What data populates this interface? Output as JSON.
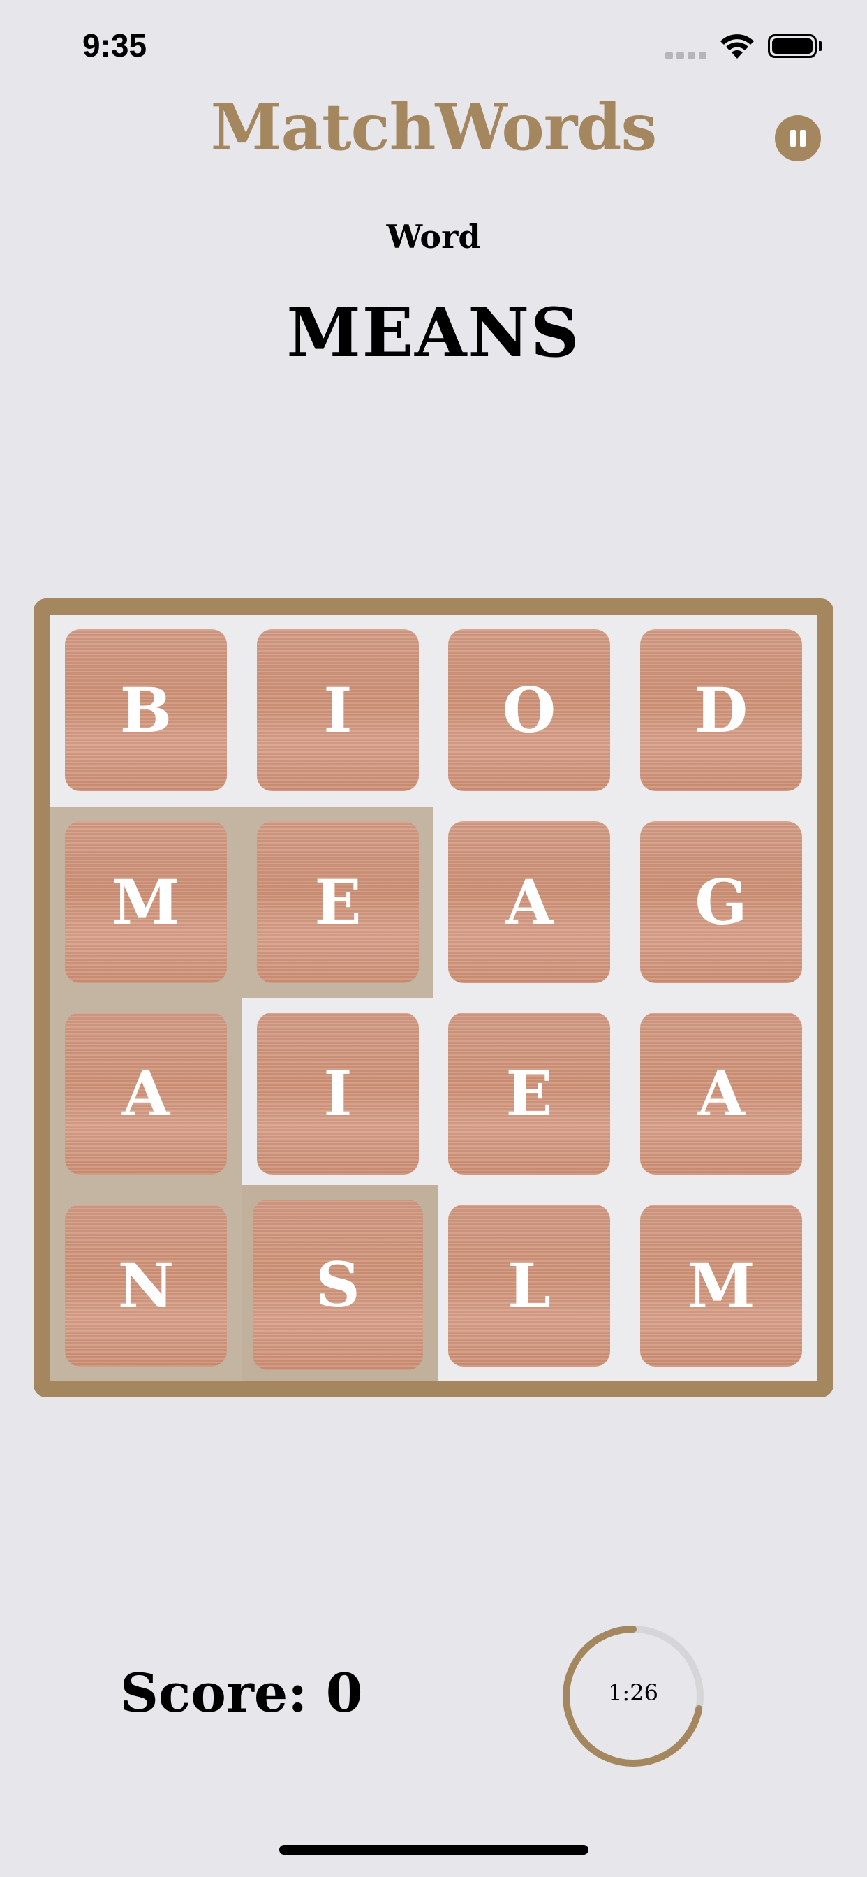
{
  "status_bar": {
    "time": "9:35"
  },
  "header": {
    "title": "MatchWords",
    "pause_icon": "pause-icon"
  },
  "prompt": {
    "label": "Word",
    "word": "MEANS"
  },
  "board": {
    "rows": [
      [
        "B",
        "I",
        "O",
        "D"
      ],
      [
        "M",
        "E",
        "A",
        "G"
      ],
      [
        "A",
        "I",
        "E",
        "A"
      ],
      [
        "N",
        "S",
        "L",
        "M"
      ]
    ],
    "selected_path": [
      "M",
      "E",
      "A",
      "N",
      "S"
    ]
  },
  "footer": {
    "score": "Score: 0",
    "timer": "1:26",
    "timer_fraction_remaining": 0.72
  },
  "colors": {
    "accent": "#a4875e",
    "background": "#e6e6eb",
    "tile": "#d59a80",
    "selection": "#c4b5a3"
  }
}
